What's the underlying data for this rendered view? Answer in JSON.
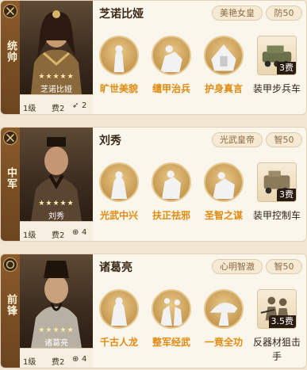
{
  "cards": [
    {
      "role": "统帅",
      "portrait_name": "芝诺比娅",
      "stars": "★★★★★",
      "level": "1级",
      "cost": "费2",
      "extra": "2",
      "general_name": "芝诺比娅",
      "tag": "美艳女皇",
      "stat": "防50",
      "skills": [
        "旷世美貌",
        "缱甲治兵",
        "护身真言"
      ],
      "equipment": {
        "fee": "3费",
        "name": "装甲步兵车"
      }
    },
    {
      "role": "中军",
      "portrait_name": "刘秀",
      "stars": "★★★★★",
      "level": "1级",
      "cost": "费2",
      "extra": "4",
      "general_name": "刘秀",
      "tag": "光武皇帝",
      "stat": "智50",
      "skills": [
        "光武中兴",
        "扶正祛邪",
        "圣智之谋"
      ],
      "equipment": {
        "fee": "3费",
        "name": "装甲控制车"
      }
    },
    {
      "role": "前锋",
      "portrait_name": "诸葛亮",
      "stars": "★★★★★",
      "level": "1级",
      "cost": "费2",
      "extra": "4",
      "general_name": "诸葛亮",
      "tag": "心明智澈",
      "stat": "智50",
      "skills": [
        "千古人龙",
        "整军经武",
        "一竟全功"
      ],
      "equipment": {
        "fee": "3.5费",
        "name": "反器材狙击手"
      }
    }
  ],
  "colors": {
    "skill_name": "#e08a10",
    "role_strip": "#7a4e24",
    "card_bg": "#fbf6ec"
  }
}
